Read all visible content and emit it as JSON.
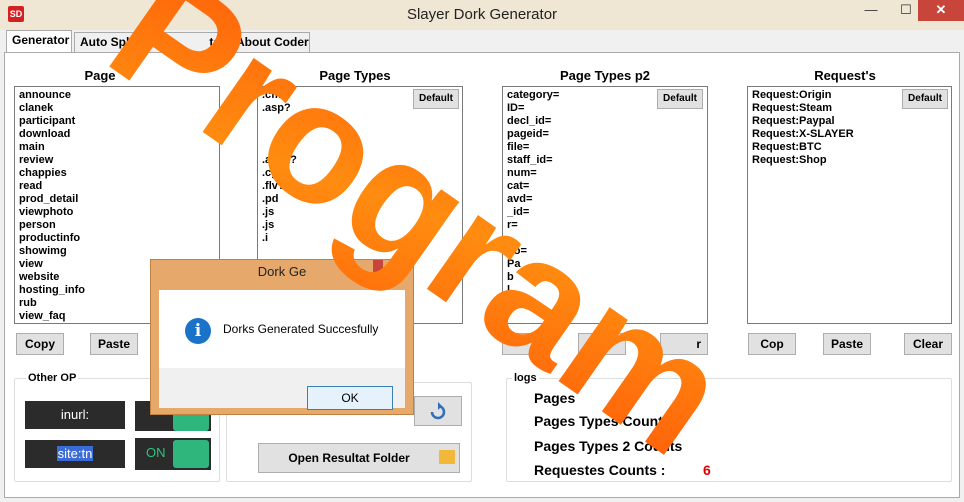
{
  "window": {
    "title": "Slayer Dork Generator",
    "minimize": "—",
    "maximize": "☐",
    "close": "✕"
  },
  "tabs": [
    "Generator",
    "Auto Spl",
    "tat",
    "About Coder"
  ],
  "columns": {
    "pages": {
      "title": "Page",
      "items": [
        "announce",
        "clanek",
        "participant",
        "download",
        "main",
        "review",
        "chappies",
        "read",
        "prod_detail",
        "viewphoto",
        "person",
        "productinfo",
        "showimg",
        "view",
        "website",
        "hosting_info",
        "rub",
        "view_faq"
      ]
    },
    "page_types": {
      "title": "Page Types",
      "items": [
        ".cfm?",
        ".asp?",
        "",
        ".aspx?",
        ".cgi?",
        ".flv?",
        ".pd",
        ".js",
        ".js",
        ".i"
      ],
      "default_label": "Default"
    },
    "page_types_p2": {
      "title": "Page Types p2",
      "items": [
        "category=",
        "ID=",
        "decl_id=",
        "pageid=",
        "file=",
        "staff_id=",
        "num=",
        "cat=",
        "avd=",
        "_id=",
        "r=",
        "",
        "do=",
        "Pa",
        "b",
        "l"
      ],
      "default_label": "Default"
    },
    "requests": {
      "title": "Request's",
      "items": [
        "Request:Origin",
        "Request:Steam",
        "Request:Paypal",
        "Request:X-SLAYER",
        "Request:BTC",
        "Request:Shop"
      ],
      "default_label": "Default"
    }
  },
  "buttons": {
    "copy": "Copy",
    "paste": "Paste",
    "clear": "Clear",
    "p2_left": "y",
    "p2_right": "r",
    "req_copy": "Cop",
    "req_paste": "Paste",
    "req_clear": "Clear",
    "open_folder": "Open Resultat Folder"
  },
  "other_op": {
    "label": "Other OP",
    "inurl": "inurl:",
    "site": "site:tn",
    "toggle1": "",
    "toggle2": "ON"
  },
  "logs": {
    "label": "logs",
    "pages_count": "Pages",
    "page_types_count": "Pages Types Count :",
    "page_types2_count": "Pages Types 2 Counts",
    "requests_count": "Requestes Counts :",
    "requests_value": "6"
  },
  "dialog": {
    "title": "Dork Ge",
    "message": "Dorks Generated Succesfully",
    "ok": "OK"
  },
  "watermark": "Program",
  "colors": {
    "titlebar": "#f0e6d4",
    "close": "#c7453b",
    "accent_red": "#e00000",
    "toggle_green": "#2eb67d",
    "dialog_frame": "#e7a86c",
    "watermark_orange": "#f06a10"
  }
}
